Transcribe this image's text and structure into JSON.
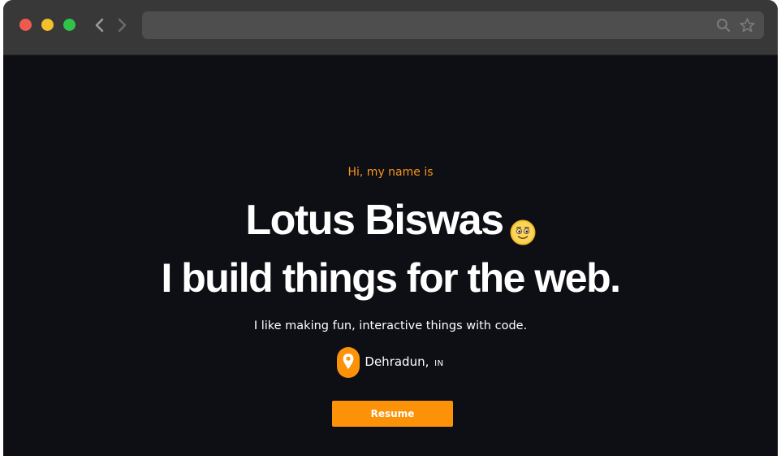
{
  "browser": {
    "url": "",
    "icons": {
      "back": "chevron-left-icon",
      "forward": "chevron-right-icon",
      "search": "search-icon",
      "bookmark": "star-icon"
    },
    "traffic_lights": {
      "close": "#ee5a4f",
      "minimize": "#f4bf2a",
      "zoom": "#2fc449"
    }
  },
  "hero": {
    "greeting": "Hi, my name is",
    "name": "Lotus Biswas",
    "name_emoji": "smiling-face-icon",
    "tagline": "I build things for the web.",
    "intro": "I like making fun, interactive things with code.",
    "location": {
      "city": "Dehradun,",
      "country": "IN",
      "icon": "map-pin-icon"
    },
    "resume_label": "Resume"
  },
  "colors": {
    "accent": "#fc9208",
    "background": "#0e0f14",
    "text": "#ffffff"
  }
}
